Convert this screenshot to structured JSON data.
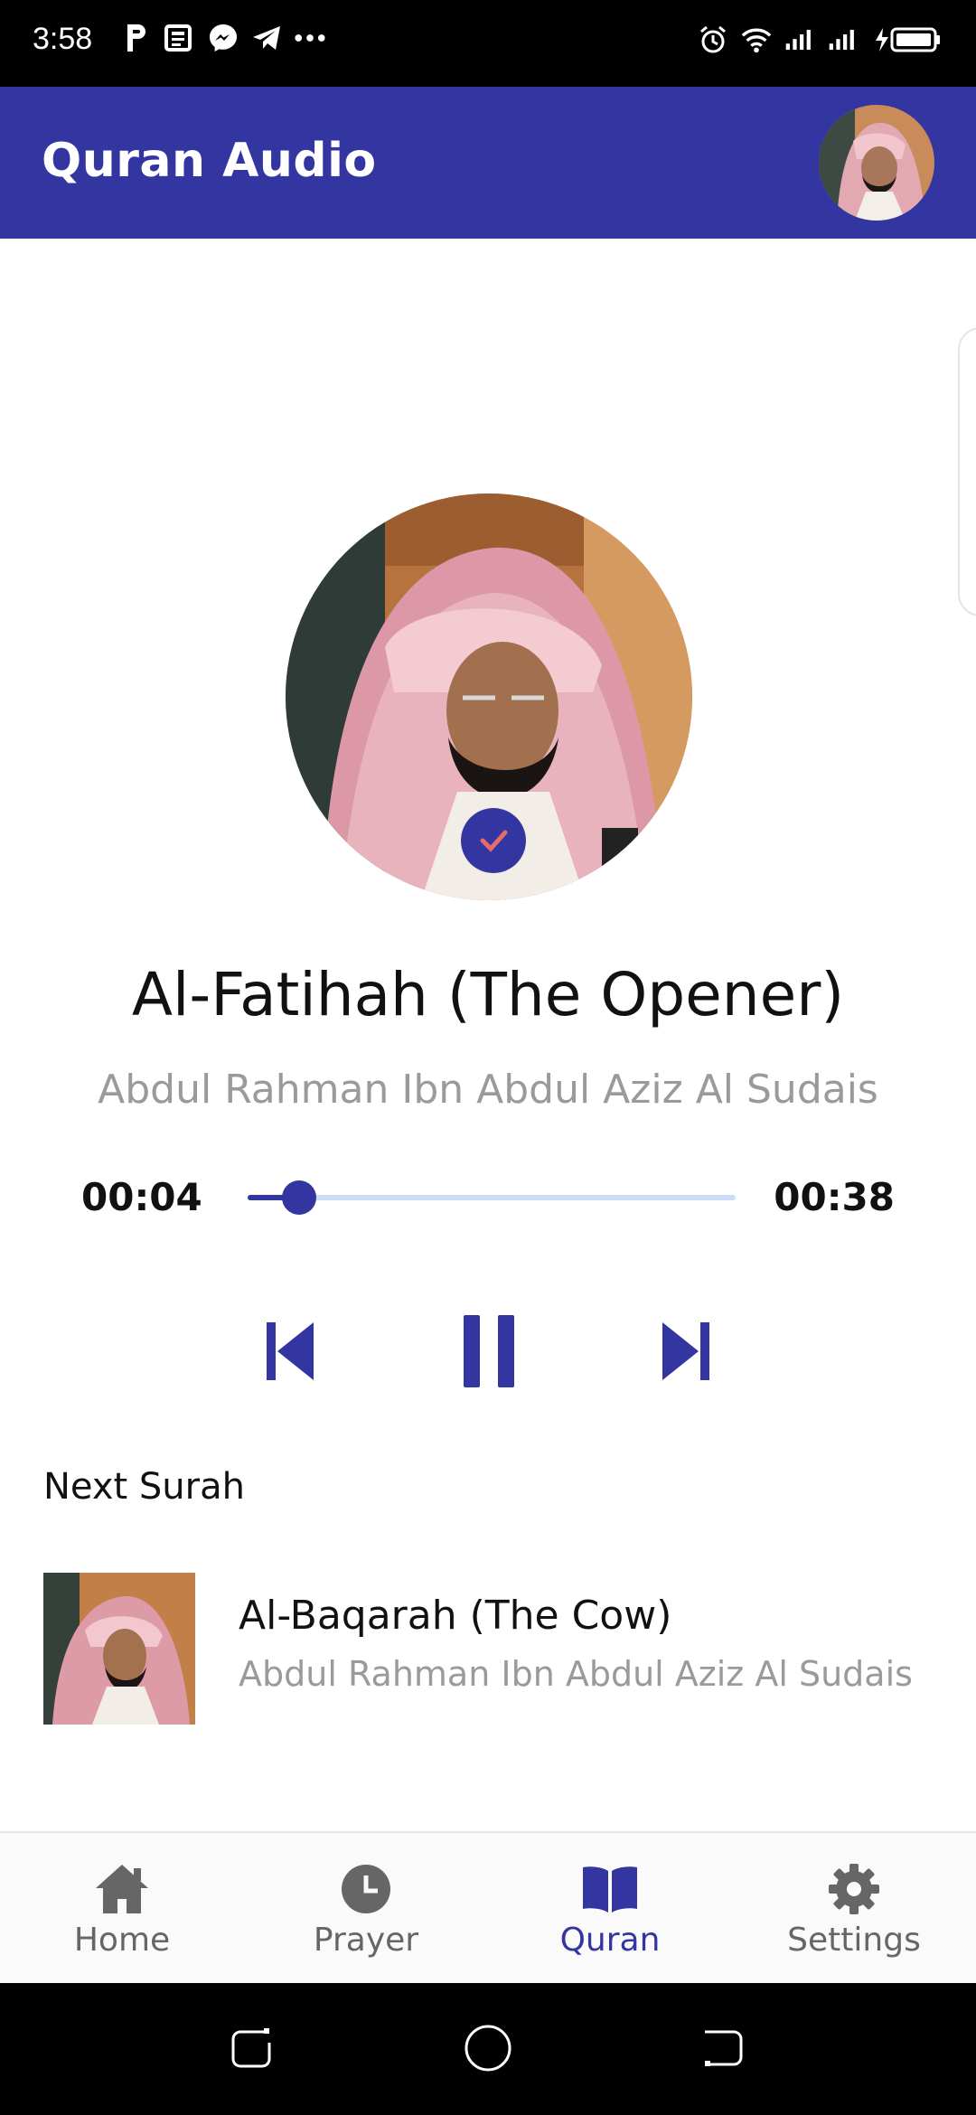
{
  "status_bar": {
    "time": "3:58",
    "left_icons": [
      "parking-icon",
      "news-icon",
      "messenger-icon",
      "telegram-icon",
      "more-dots-icon"
    ],
    "right_icons": [
      "alarm-icon",
      "wifi-icon",
      "signal-icon",
      "signal-icon",
      "battery-charging-icon"
    ]
  },
  "app_bar": {
    "title": "Quran Audio",
    "avatar_icon": "reciter-avatar"
  },
  "player": {
    "title": "Al-Fatihah (The Opener)",
    "artist": "Abdul Rahman Ibn Abdul Aziz Al Sudais",
    "current_time": "00:04",
    "total_time": "00:38",
    "progress_fraction": 0.105,
    "controls": [
      "skip-previous-icon",
      "pause-icon",
      "skip-next-icon"
    ],
    "accent_color": "#3335a0"
  },
  "next_section": {
    "header": "Next Surah",
    "items": [
      {
        "title": "Al-Baqarah (The Cow)",
        "artist": "Abdul Rahman Ibn Abdul Aziz Al Sudais"
      }
    ]
  },
  "bottom_nav": {
    "items": [
      {
        "label": "Home",
        "icon": "home-icon",
        "active": false
      },
      {
        "label": "Prayer",
        "icon": "clock-icon",
        "active": false
      },
      {
        "label": "Quran",
        "icon": "book-icon",
        "active": true
      },
      {
        "label": "Settings",
        "icon": "gear-icon",
        "active": false
      }
    ]
  },
  "system_nav": [
    "recent-apps-icon",
    "home-circle-icon",
    "back-icon"
  ]
}
